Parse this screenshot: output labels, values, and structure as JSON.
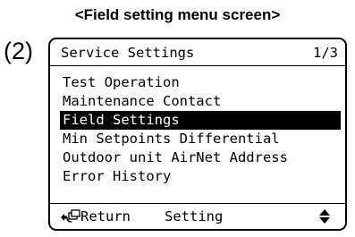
{
  "caption": "<Field setting menu screen>",
  "step_label": "(2)",
  "screen": {
    "title": "Service Settings",
    "page": "1/3",
    "menu_items": [
      {
        "label": "Test Operation",
        "selected": false
      },
      {
        "label": "Maintenance Contact",
        "selected": false
      },
      {
        "label": "Field Settings",
        "selected": true
      },
      {
        "label": "Min Setpoints Differential",
        "selected": false
      },
      {
        "label": "Outdoor unit AirNet Address",
        "selected": false
      },
      {
        "label": "Error History",
        "selected": false
      }
    ],
    "footer": {
      "return_label": "Return",
      "return_icon": "return-icon",
      "setting_label": "Setting",
      "scroll_icon": "up-down-arrows-icon"
    }
  }
}
